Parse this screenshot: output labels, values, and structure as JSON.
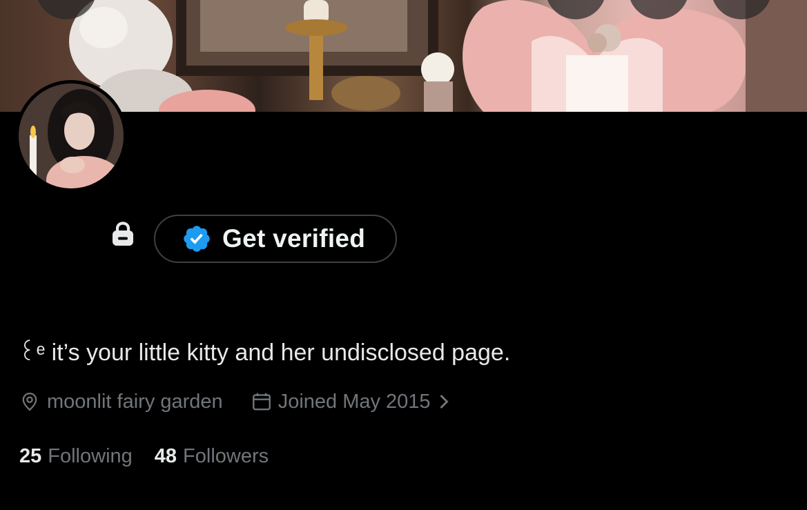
{
  "profile": {
    "verify_button_label": "Get verified",
    "bio": "꒰ᵉ it’s your little kitty and her undisclosed page.",
    "location": "moonlit fairy garden",
    "joined": "Joined May 2015"
  },
  "stats": {
    "following_count": "25",
    "following_label": "Following",
    "followers_count": "48",
    "followers_label": "Followers"
  },
  "icons": {
    "lock": "lock-icon",
    "verified_badge": "verified-badge-icon",
    "location": "location-pin-icon",
    "calendar": "calendar-icon",
    "chevron": "chevron-right-icon"
  },
  "colors": {
    "background": "#000000",
    "primary_text": "#e7e9ea",
    "secondary_text": "#71767b",
    "verified_blue": "#1d9bf0",
    "button_border": "#3e4144"
  }
}
